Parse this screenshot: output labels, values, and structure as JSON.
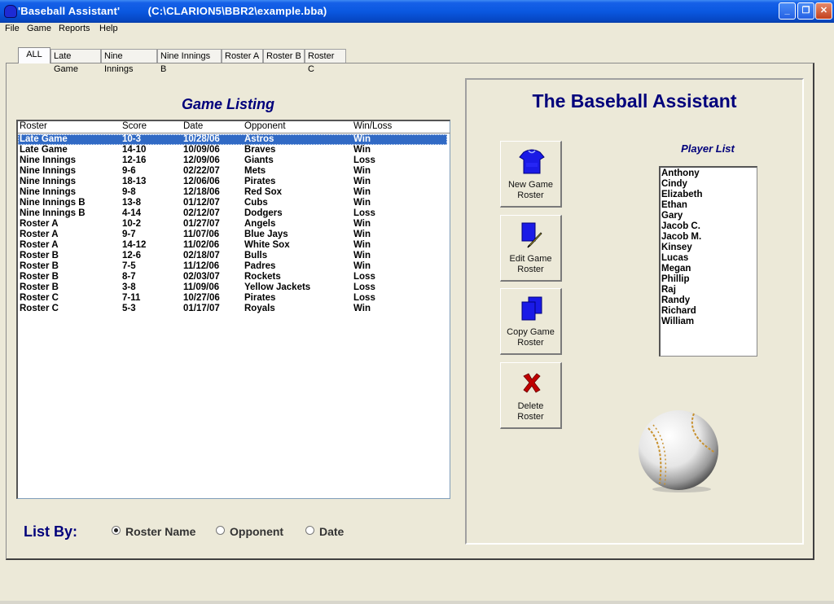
{
  "window": {
    "title": "'Baseball Assistant'         (C:\\CLARION5\\BBR2\\example.bba)",
    "minimize": "_",
    "restore": "❐",
    "close": "✕"
  },
  "menu": [
    "File",
    "Game",
    "Reports",
    "Help"
  ],
  "tabs": [
    "ALL",
    "Late Game",
    "Nine Innings",
    "Nine Innings B",
    "Roster A",
    "Roster B",
    "Roster C"
  ],
  "game_listing": {
    "title": "Game Listing",
    "columns": [
      "Roster",
      "Score",
      "Date",
      "Opponent",
      "Win/Loss"
    ],
    "rows": [
      [
        "Late Game",
        "10-3",
        "10/28/06",
        "Astros",
        "Win"
      ],
      [
        "Late Game",
        "14-10",
        "10/09/06",
        "Braves",
        "Win"
      ],
      [
        "Nine Innings",
        "12-16",
        "12/09/06",
        "Giants",
        "Loss"
      ],
      [
        "Nine Innings",
        "9-6",
        "02/22/07",
        "Mets",
        "Win"
      ],
      [
        "Nine Innings",
        "18-13",
        "12/06/06",
        "Pirates",
        "Win"
      ],
      [
        "Nine Innings",
        "9-8",
        "12/18/06",
        "Red Sox",
        "Win"
      ],
      [
        "Nine Innings B",
        "13-8",
        "01/12/07",
        "Cubs",
        "Win"
      ],
      [
        "Nine Innings B",
        "4-14",
        "02/12/07",
        "Dodgers",
        "Loss"
      ],
      [
        "Roster A",
        "10-2",
        "01/27/07",
        "Angels",
        "Win"
      ],
      [
        "Roster A",
        "9-7",
        "11/07/06",
        "Blue Jays",
        "Win"
      ],
      [
        "Roster A",
        "14-12",
        "11/02/06",
        "White Sox",
        "Win"
      ],
      [
        "Roster B",
        "12-6",
        "02/18/07",
        "Bulls",
        "Win"
      ],
      [
        "Roster B",
        "7-5",
        "11/12/06",
        "Padres",
        "Win"
      ],
      [
        "Roster B",
        "8-7",
        "02/03/07",
        "Rockets",
        "Loss"
      ],
      [
        "Roster B",
        "3-8",
        "11/09/06",
        "Yellow Jackets",
        "Loss"
      ],
      [
        "Roster C",
        "7-11",
        "10/27/06",
        "Pirates",
        "Loss"
      ],
      [
        "Roster C",
        "5-3",
        "01/17/07",
        "Royals",
        "Win"
      ]
    ]
  },
  "list_by": {
    "label": "List By:",
    "options": [
      "Roster Name",
      "Opponent",
      "Date"
    ],
    "selected": "Roster Name"
  },
  "app_title": "The Baseball Assistant",
  "buttons": {
    "new": [
      "New Game",
      "Roster"
    ],
    "edit": [
      "Edit Game",
      "Roster"
    ],
    "copy": [
      "Copy Game",
      "Roster"
    ],
    "delete": [
      "Delete",
      "Roster"
    ]
  },
  "player_list": {
    "title": "Player List",
    "players": [
      "Anthony",
      "Cindy",
      "Elizabeth",
      "Ethan",
      "Gary",
      "Jacob C.",
      "Jacob M.",
      "Kinsey",
      "Lucas",
      "Megan",
      "Phillip",
      "Raj",
      "Randy",
      "Richard",
      "William"
    ]
  },
  "colors": {
    "heading": "#00007b",
    "selection": "#316ac5",
    "icon_blue": "#1a1ae6",
    "delete_red": "#c00000"
  }
}
